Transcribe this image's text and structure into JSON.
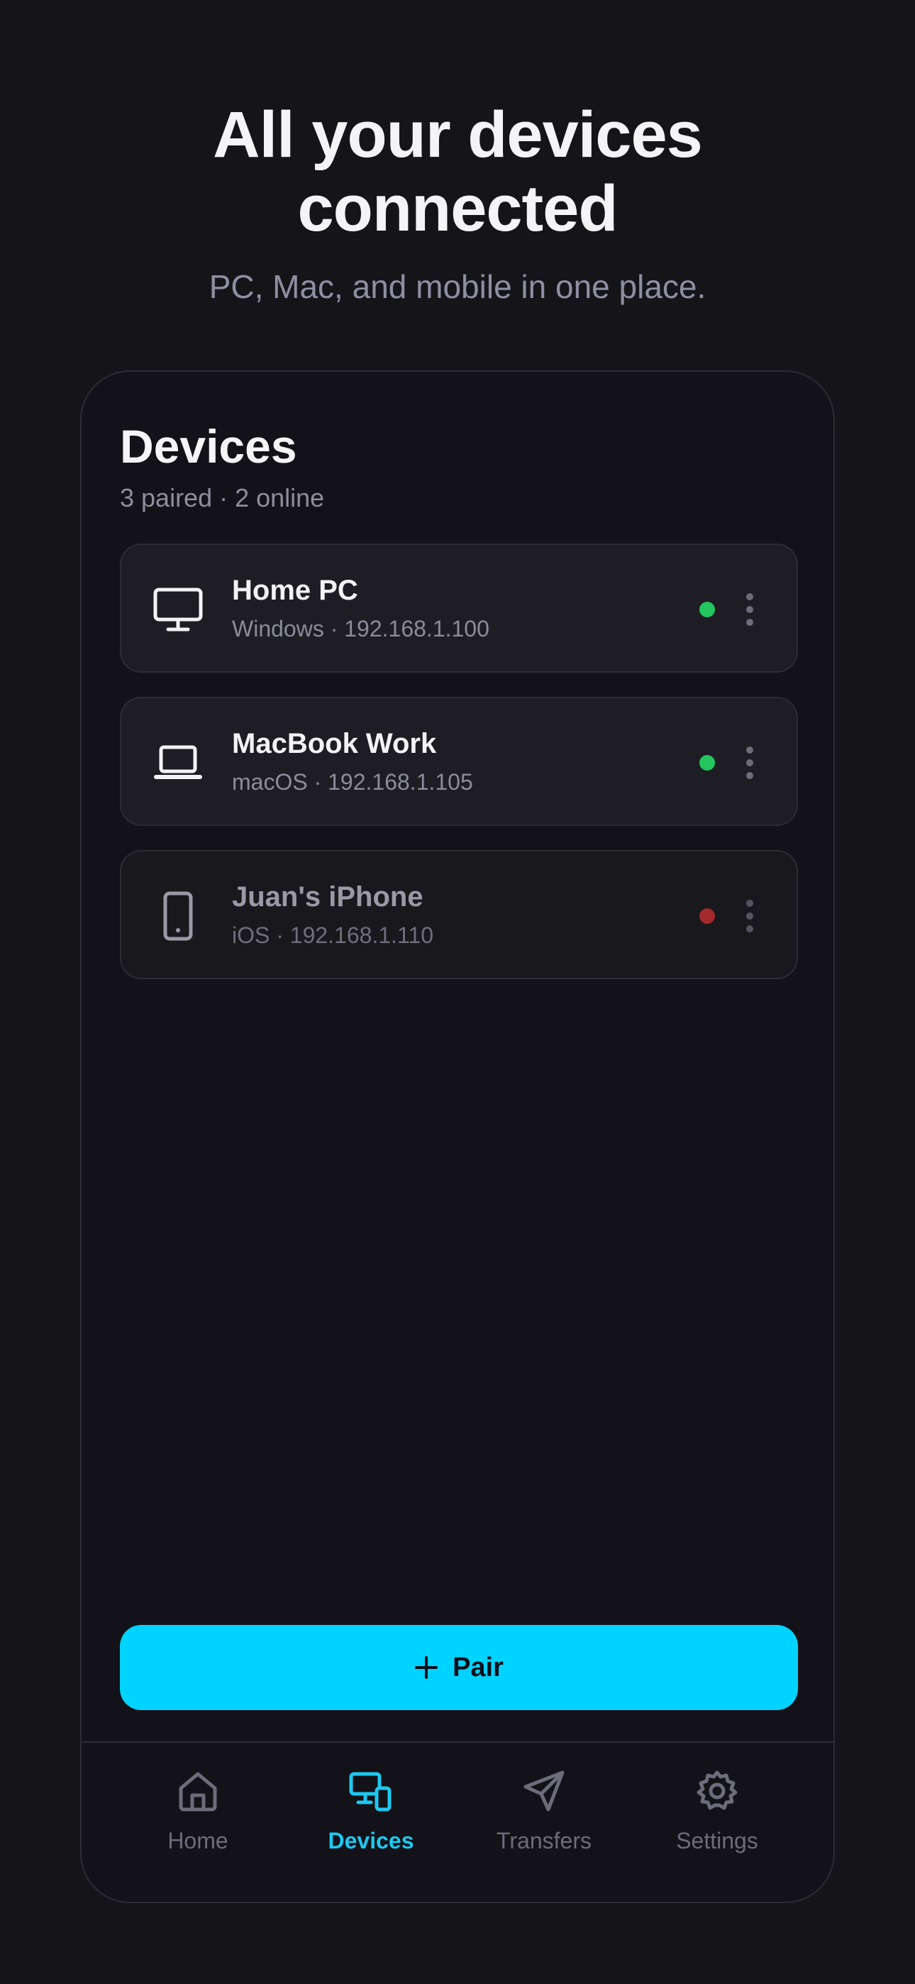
{
  "hero": {
    "title_line1": "All your devices",
    "title_line2": "connected",
    "subtitle": "PC, Mac, and mobile in one place."
  },
  "screen": {
    "title": "Devices",
    "subtitle": "3 paired · 2 online"
  },
  "devices": [
    {
      "name": "Home PC",
      "meta": "Windows · 192.168.1.100",
      "icon": "desktop-icon",
      "status": "online"
    },
    {
      "name": "MacBook Work",
      "meta": "macOS · 192.168.1.105",
      "icon": "laptop-icon",
      "status": "online"
    },
    {
      "name": "Juan's iPhone",
      "meta": "iOS · 192.168.1.110",
      "icon": "phone-icon",
      "status": "offline"
    }
  ],
  "pair_button": {
    "label": "Pair",
    "icon": "plus-icon"
  },
  "nav": [
    {
      "label": "Home",
      "icon": "home-icon",
      "active": false
    },
    {
      "label": "Devices",
      "icon": "devices-icon",
      "active": true
    },
    {
      "label": "Transfers",
      "icon": "send-icon",
      "active": false
    },
    {
      "label": "Settings",
      "icon": "gear-icon",
      "active": false
    }
  ],
  "colors": {
    "background": "#141419",
    "accent": "#00d3ff",
    "online": "#22c55e",
    "offline": "#a3292c"
  }
}
